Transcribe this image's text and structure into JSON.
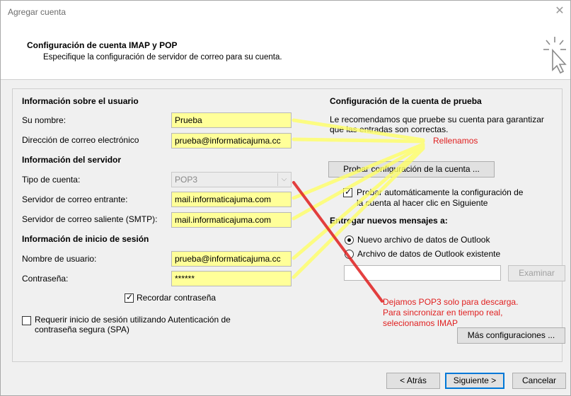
{
  "window": {
    "title": "Agregar cuenta",
    "close_glyph": "✕"
  },
  "header": {
    "title": "Configuración de cuenta IMAP y POP",
    "subtitle": "Especifique la configuración de servidor de correo para su cuenta."
  },
  "user_info": {
    "section": "Información sobre el usuario",
    "name_label": "Su nombre:",
    "name_value": "Prueba",
    "email_label": "Dirección de correo electrónico",
    "email_value": "prueba@informaticajuma.cc"
  },
  "server_info": {
    "section": "Información del servidor",
    "type_label": "Tipo de cuenta:",
    "type_value": "POP3",
    "incoming_label": "Servidor de correo entrante:",
    "incoming_value": "mail.informaticajuma.com",
    "outgoing_label": "Servidor de correo saliente (SMTP):",
    "outgoing_value": "mail.informaticajuma.com"
  },
  "login_info": {
    "section": "Información de inicio de sesión",
    "user_label": "Nombre de usuario:",
    "user_value": "prueba@informaticajuma.cc",
    "password_label": "Contraseña:",
    "password_value": "******",
    "remember_label": "Recordar contraseña",
    "spa_label_1": "Requerir inicio de sesión utilizando Autenticación de",
    "spa_label_2": "contraseña segura (SPA)"
  },
  "test": {
    "section": "Configuración de la cuenta de prueba",
    "desc_1": "Le recomendamos que pruebe su cuenta para garantizar",
    "desc_2": "que las entradas son correctas.",
    "test_button": "Probar configuración de la cuenta ...",
    "auto_test_1": "Probar automáticamente la configuración de",
    "auto_test_2": "la cuenta al hacer clic en Siguiente",
    "deliver_label": "Entregar nuevos mensajes a:",
    "new_file_label": "Nuevo archivo de datos de Outlook",
    "existing_file_label": "Archivo de datos de Outlook existente",
    "browse_button": "Examinar",
    "more_settings_button": "Más configuraciones ..."
  },
  "footer": {
    "back_button": "< Atrás",
    "next_button": "Siguiente >",
    "cancel_button": "Cancelar"
  },
  "annotations": {
    "filled_text": "Rellenamos",
    "pop3_line_1": "Dejamos POP3 solo para descarga.",
    "pop3_line_2": "Para sincronizar en tiempo real,",
    "pop3_line_3": "selecionamos IMAP",
    "color_red": "#e02020",
    "color_yellow": "#ffff66"
  },
  "colors": {
    "field_highlight": "#ffff99",
    "dialog_bg": "#f0f0f0",
    "accent": "#0078d7"
  }
}
